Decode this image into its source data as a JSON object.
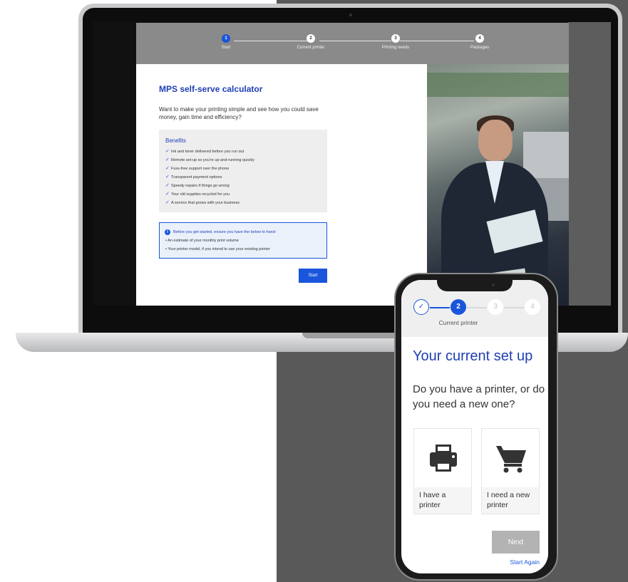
{
  "laptop_app": {
    "steps": [
      {
        "num": "1",
        "label": "Start"
      },
      {
        "num": "2",
        "label": "Current printer"
      },
      {
        "num": "3",
        "label": "Printing needs"
      },
      {
        "num": "4",
        "label": "Packages"
      }
    ],
    "title": "MPS self-serve calculator",
    "intro": "Want to make your printing simple and see how you could save money, gain time and efficiency?",
    "benefits_title": "Benefits",
    "benefits": [
      "Ink and toner delivered before you run out",
      "Remote set-up so you're up-and-running quickly",
      "Fuss-free support over the phone",
      "Transparent payment options",
      "Speedy repairs if things go wrong",
      "Your old supplies recycled for you",
      "A service that grows with your business"
    ],
    "info": {
      "heading": "Before you get started, ensure you have the below to hand:",
      "bullets": [
        "An estimate of your monthly print volume",
        "Your printer model, if you intend to use your existing printer"
      ]
    },
    "start_label": "Start"
  },
  "phone_app": {
    "steps": [
      {
        "num": "✓",
        "state": "done"
      },
      {
        "num": "2",
        "state": "active"
      },
      {
        "num": "3",
        "state": "todo"
      },
      {
        "num": "4",
        "state": "todo"
      }
    ],
    "current_step_label": "Current printer",
    "title": "Your current set up",
    "question": "Do you have a printer, or do you need a new one?",
    "options": [
      {
        "label": "I have a printer",
        "icon": "printer-icon"
      },
      {
        "label": "I need a new printer",
        "icon": "shopping-cart-icon"
      }
    ],
    "next_label": "Next",
    "start_again_label": "Start Again"
  },
  "colors": {
    "accent": "#1a56db",
    "title_blue": "#1f3fb5",
    "stepper_bg": "#8a8a8a",
    "disabled_button": "#b3b3b3",
    "page_dark": "#595959"
  }
}
